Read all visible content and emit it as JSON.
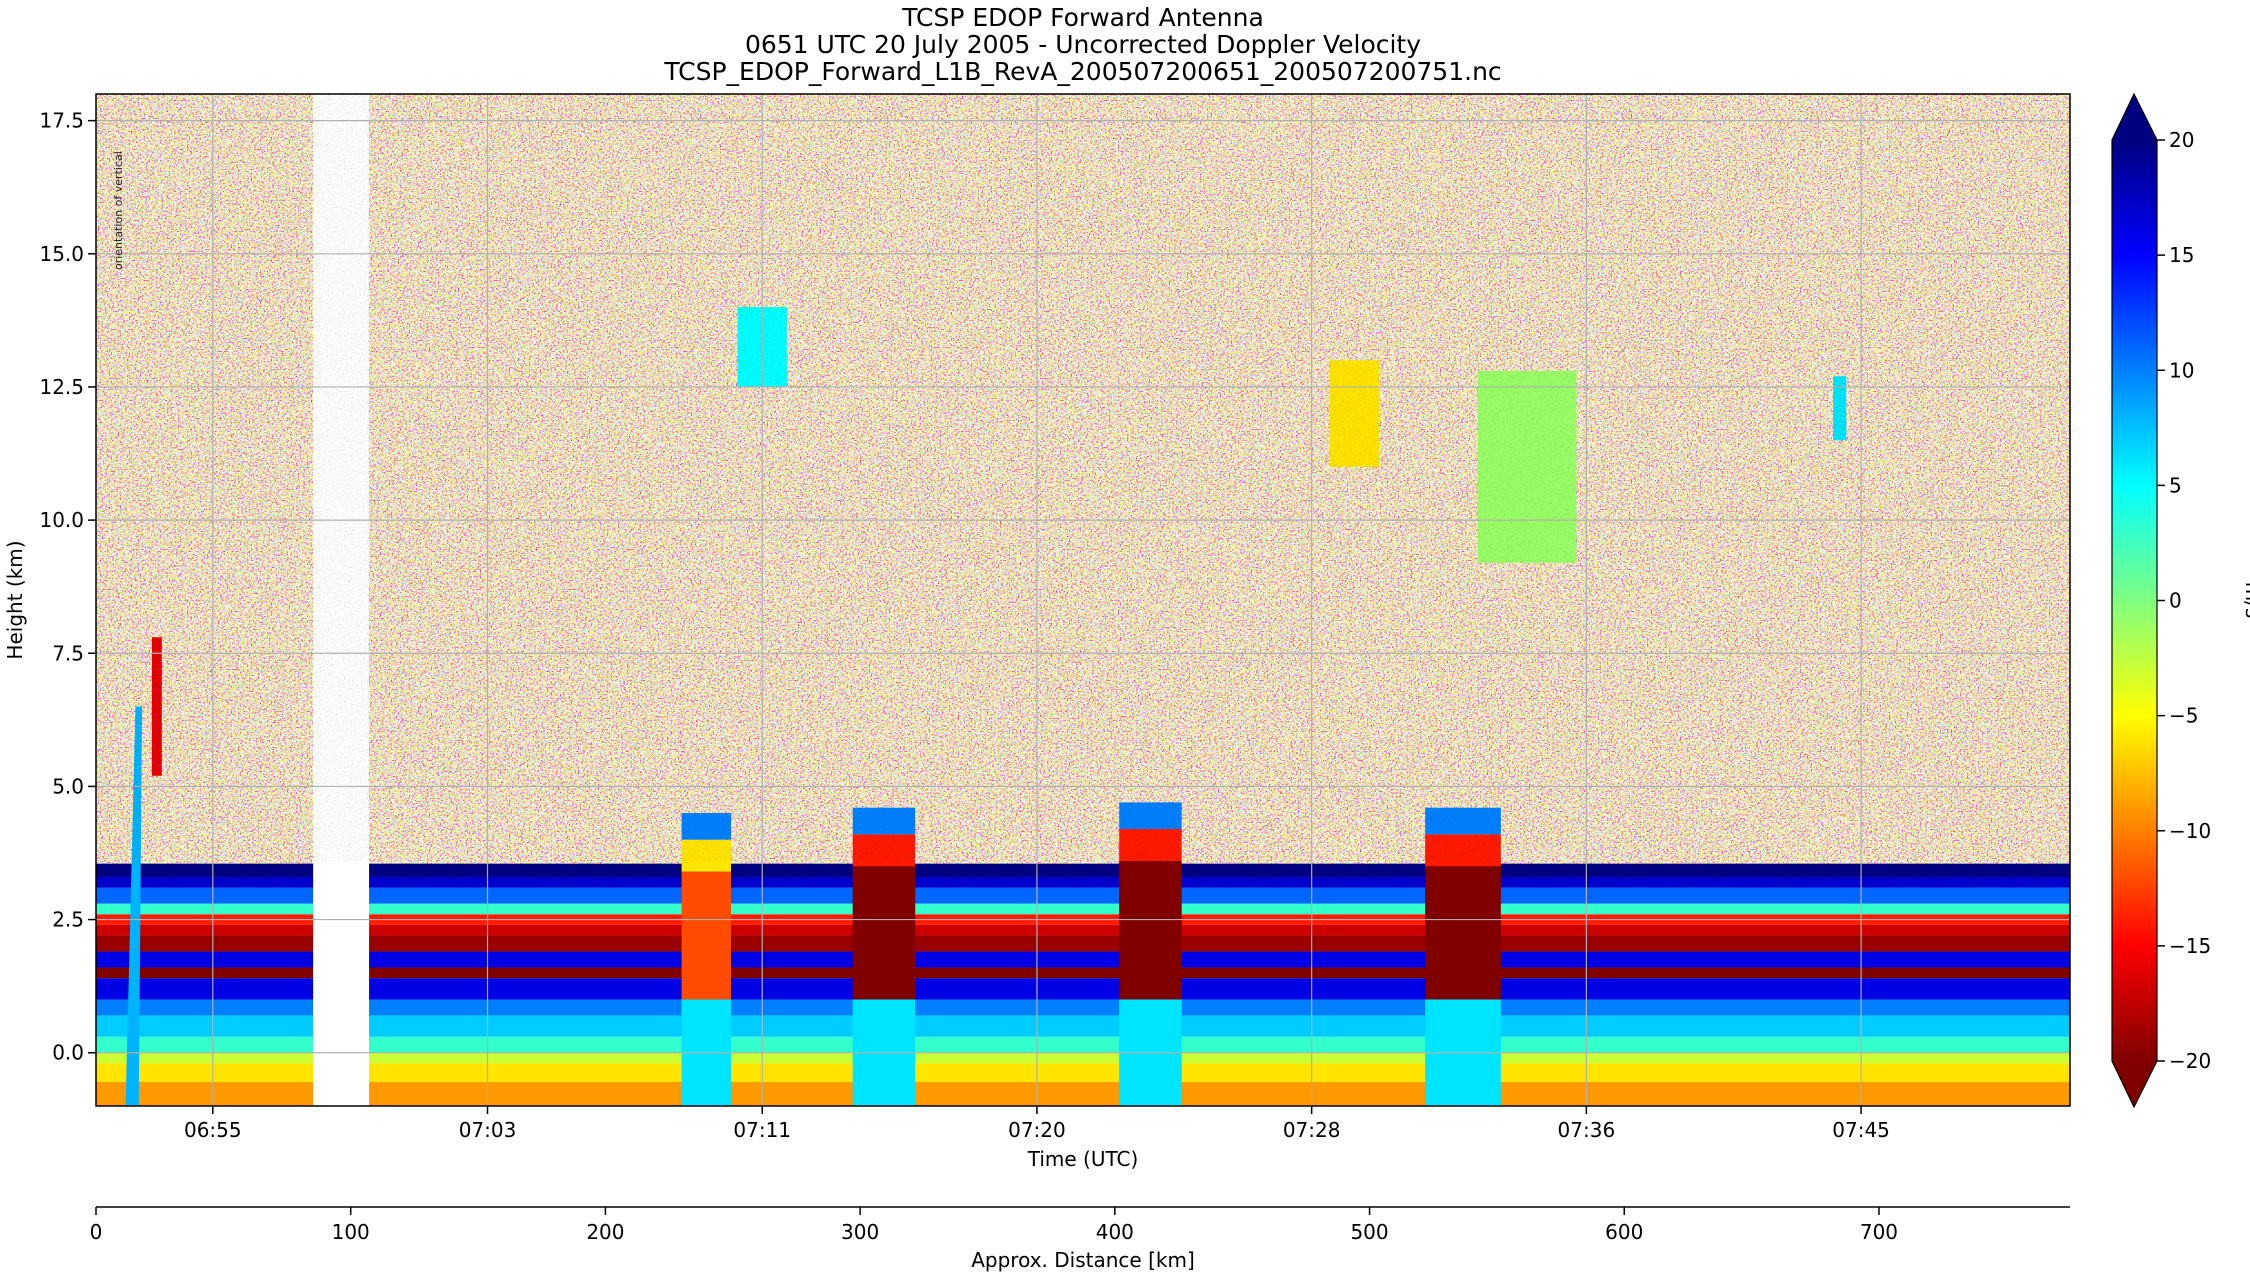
{
  "chart_data": {
    "type": "heatmap",
    "title_lines": [
      "TCSP EDOP Forward Antenna",
      "0651 UTC 20 July 2005 - Uncorrected Doppler Velocity",
      "TCSP_EDOP_Forward_L1B_RevA_200507200651_200507200751.nc"
    ],
    "xlabel": "Time (UTC)",
    "ylabel": "Height (km)",
    "x_tick_labels": [
      "06:55",
      "07:03",
      "07:11",
      "07:20",
      "07:28",
      "07:36",
      "07:45"
    ],
    "x_tick_positions_min_after_0651": [
      3.55,
      11.9,
      20.25,
      28.6,
      36.95,
      45.3,
      53.65
    ],
    "x_range_min_after_0651": [
      0,
      60
    ],
    "ylim": [
      -1.0,
      18.0
    ],
    "y_ticks": [
      0.0,
      2.5,
      5.0,
      7.5,
      10.0,
      12.5,
      15.0,
      17.5
    ],
    "y_tick_labels": [
      "0.0",
      "2.5",
      "5.0",
      "7.5",
      "10.0",
      "12.5",
      "15.0",
      "17.5"
    ],
    "grid": true,
    "annotation": "orientation of vertical",
    "colorbar": {
      "label": "m/s",
      "range": [
        -20,
        20
      ],
      "ticks": [
        -20,
        -15,
        -10,
        -5,
        0,
        5,
        10,
        15,
        20
      ],
      "tick_labels": [
        "−20",
        "−15",
        "−10",
        "−5",
        "0",
        "5",
        "10",
        "15",
        "20"
      ],
      "colormap": "jet_r",
      "extend": "both"
    },
    "secondary_axis": {
      "label": "Approx. Distance [km]",
      "ticks": [
        0,
        100,
        200,
        300,
        400,
        500,
        600,
        700
      ],
      "tick_labels": [
        "0",
        "100",
        "200",
        "300",
        "400",
        "500",
        "600",
        "700"
      ],
      "range": [
        0,
        775
      ]
    },
    "data_gaps_min_after_0651": [
      [
        6.6,
        8.3
      ]
    ],
    "velocity_structure": {
      "surface_echo": {
        "height_km": [
          -1.0,
          0.0
        ],
        "velocity_ms": -8
      },
      "near_surface": {
        "height_km": [
          0.0,
          1.0
        ],
        "velocity_ms": 7
      },
      "bright_band_km": 2.5,
      "melting_layer_top_km": 3.5,
      "upper_noise_velocity_ms": [
        -20,
        20
      ]
    },
    "rain_cells_min_after_0651": [
      {
        "t": [
          17.8,
          19.3
        ],
        "top_km": 4.5,
        "core_velocity_ms": -12
      },
      {
        "t": [
          23.0,
          24.9
        ],
        "top_km": 4.6,
        "core_velocity_ms": -20
      },
      {
        "t": [
          31.1,
          33.0
        ],
        "top_km": 4.7,
        "core_velocity_ms": -20
      },
      {
        "t": [
          40.4,
          42.7
        ],
        "top_km": 4.6,
        "core_velocity_ms": -20
      }
    ],
    "upper_features_min_after_0651": [
      {
        "t": [
          19.5,
          21.0
        ],
        "height_km": [
          12.5,
          14.0
        ],
        "velocity_ms": 5
      },
      {
        "t": [
          37.5,
          39.0
        ],
        "height_km": [
          11.0,
          13.0
        ],
        "velocity_ms": -6
      },
      {
        "t": [
          42.0,
          45.0
        ],
        "height_km": [
          9.2,
          12.8
        ],
        "velocity_ms": -1
      },
      {
        "t": [
          52.8,
          53.2
        ],
        "height_km": [
          11.5,
          12.7
        ],
        "velocity_ms": 6
      }
    ]
  }
}
